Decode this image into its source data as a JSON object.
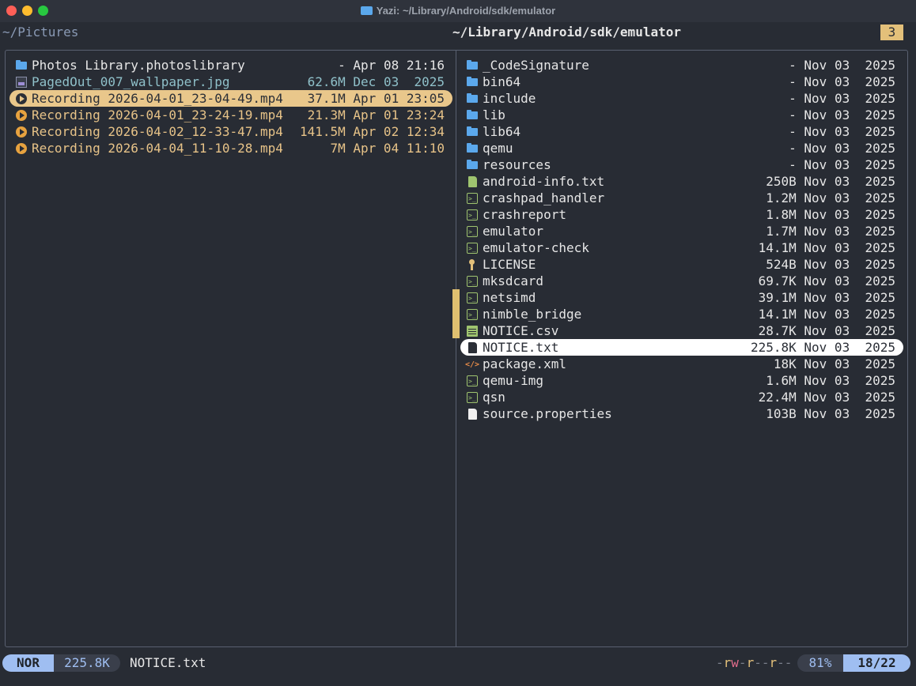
{
  "window": {
    "title": "Yazi: ~/Library/Android/sdk/emulator"
  },
  "header": {
    "parent_path": "~/Pictures",
    "current_path": "~/Library/Android/sdk/emulator",
    "tab_count": "3"
  },
  "left_pane": {
    "items": [
      {
        "name": "Photos Library.photoslibrary",
        "meta": "- Apr 08 21:16",
        "icon": "folder-icon",
        "kind": "folder"
      },
      {
        "name": "PagedOut_007_wallpaper.jpg",
        "meta": "62.6M Dec 03  2025",
        "icon": "image-icon",
        "kind": "img"
      },
      {
        "name": "Recording 2026-04-01_23-04-49.mp4",
        "meta": "37.1M Apr 01 23:05",
        "icon": "play-icon",
        "kind": "vid",
        "selected": true
      },
      {
        "name": "Recording 2026-04-01_23-24-19.mp4",
        "meta": "21.3M Apr 01 23:24",
        "icon": "play-icon",
        "kind": "vid"
      },
      {
        "name": "Recording 2026-04-02_12-33-47.mp4",
        "meta": "141.5M Apr 02 12:34",
        "icon": "play-icon",
        "kind": "vid"
      },
      {
        "name": "Recording 2026-04-04_11-10-28.mp4",
        "meta": "7M Apr 04 11:10",
        "icon": "play-icon",
        "kind": "vid"
      }
    ]
  },
  "right_pane": {
    "items": [
      {
        "name": "_CodeSignature",
        "meta": "- Nov 03  2025",
        "icon": "folder-icon"
      },
      {
        "name": "bin64",
        "meta": "- Nov 03  2025",
        "icon": "folder-icon"
      },
      {
        "name": "include",
        "meta": "- Nov 03  2025",
        "icon": "folder-icon"
      },
      {
        "name": "lib",
        "meta": "- Nov 03  2025",
        "icon": "folder-icon"
      },
      {
        "name": "lib64",
        "meta": "- Nov 03  2025",
        "icon": "folder-icon"
      },
      {
        "name": "qemu",
        "meta": "- Nov 03  2025",
        "icon": "folder-icon"
      },
      {
        "name": "resources",
        "meta": "- Nov 03  2025",
        "icon": "folder-icon"
      },
      {
        "name": "android-info.txt",
        "meta": "250B Nov 03  2025",
        "icon": "document-icon"
      },
      {
        "name": "crashpad_handler",
        "meta": "1.2M Nov 03  2025",
        "icon": "terminal-icon"
      },
      {
        "name": "crashreport",
        "meta": "1.8M Nov 03  2025",
        "icon": "terminal-icon"
      },
      {
        "name": "emulator",
        "meta": "1.7M Nov 03  2025",
        "icon": "terminal-icon"
      },
      {
        "name": "emulator-check",
        "meta": "14.1M Nov 03  2025",
        "icon": "terminal-icon"
      },
      {
        "name": "LICENSE",
        "meta": "524B Nov 03  2025",
        "icon": "license-icon"
      },
      {
        "name": "mksdcard",
        "meta": "69.7K Nov 03  2025",
        "icon": "terminal-icon"
      },
      {
        "name": "netsimd",
        "meta": "39.1M Nov 03  2025",
        "icon": "terminal-icon"
      },
      {
        "name": "nimble_bridge",
        "meta": "14.1M Nov 03  2025",
        "icon": "terminal-icon"
      },
      {
        "name": "NOTICE.csv",
        "meta": "28.7K Nov 03  2025",
        "icon": "spreadsheet-icon"
      },
      {
        "name": "NOTICE.txt",
        "meta": "225.8K Nov 03  2025",
        "icon": "text-file-icon",
        "current": true
      },
      {
        "name": "package.xml",
        "meta": "18K Nov 03  2025",
        "icon": "code-icon"
      },
      {
        "name": "qemu-img",
        "meta": "1.6M Nov 03  2025",
        "icon": "terminal-icon"
      },
      {
        "name": "qsn",
        "meta": "22.4M Nov 03  2025",
        "icon": "terminal-icon"
      },
      {
        "name": "source.properties",
        "meta": "103B Nov 03  2025",
        "icon": "file-icon"
      }
    ]
  },
  "status": {
    "mode": "NOR",
    "size": "225.8K",
    "filename": "NOTICE.txt",
    "permissions": "-rw-r--r--",
    "percent": "81%",
    "position": "18/22"
  }
}
